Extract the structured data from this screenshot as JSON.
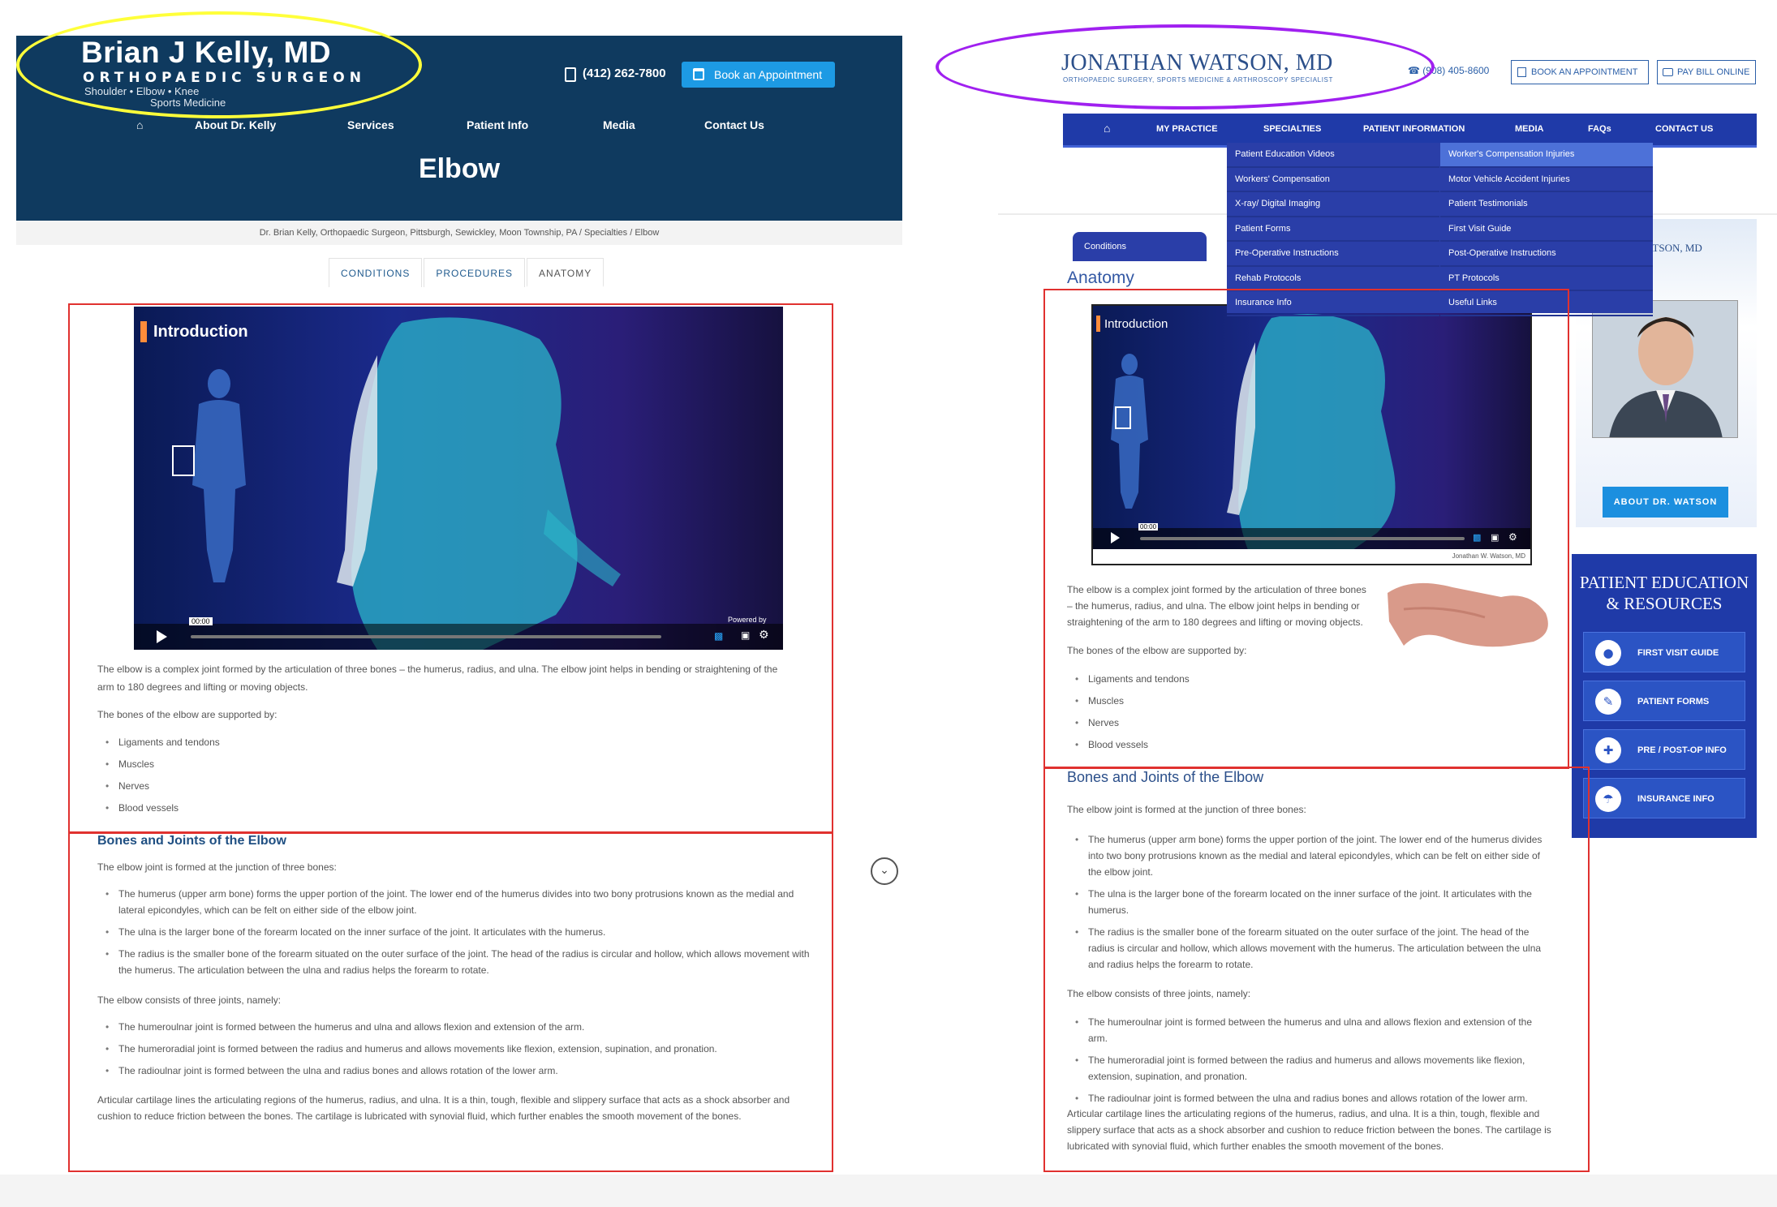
{
  "left_site": {
    "doctor_name": "Brian J Kelly, MD",
    "subtitle": "ORTHOPAEDIC SURGEON",
    "specialties": "Shoulder   •   Elbow   •   Knee",
    "sports": "Sports Medicine",
    "phone": "(412) 262-7800",
    "book_label": "Book an Appointment",
    "nav": [
      "About Dr. Kelly",
      "Services",
      "Patient Info",
      "Media",
      "Contact Us"
    ],
    "page_title": "Elbow",
    "breadcrumb": "Dr. Brian Kelly, Orthopaedic Surgeon, Pittsburgh, Sewickley, Moon Township, PA / Specialties / Elbow",
    "tabs": [
      "CONDITIONS",
      "PROCEDURES",
      "ANATOMY"
    ],
    "video": {
      "intro": "Introduction",
      "time": "00:00",
      "powered": "Powered by"
    },
    "intro_p1": "The elbow is a complex joint formed by the articulation of three bones – the humerus, radius, and ulna. The elbow joint helps in bending or straightening of the arm to 180 degrees and lifting or moving objects.",
    "intro_p2": "The bones of the elbow are supported by:",
    "supports": [
      "Ligaments and tendons",
      "Muscles",
      "Nerves",
      "Blood vessels"
    ],
    "bones_heading": "Bones and Joints of the Elbow",
    "bones_intro": "The elbow joint is formed at the junction of three bones:",
    "bones": [
      "The humerus (upper arm bone) forms the upper portion of the joint. The lower end of the humerus divides into two bony protrusions known as the medial and lateral epicondyles, which can be felt on either side of the elbow joint.",
      "The ulna is the larger bone of the forearm located on the inner surface of the joint. It articulates with the humerus.",
      "The radius is the smaller bone of the forearm situated on the outer surface of the joint. The head of the radius is circular and hollow, which allows movement with the humerus. The articulation between the ulna and radius helps the forearm to rotate."
    ],
    "joints_intro": "The elbow consists of three joints, namely:",
    "joints": [
      "The humeroulnar joint is formed between the humerus and ulna and allows flexion and extension of the arm.",
      "The humeroradial joint is formed between the radius and humerus and allows movements like flexion, extension, supination, and pronation.",
      "The radioulnar joint is formed between the ulna and radius bones and allows rotation of the lower arm."
    ],
    "cartilage": "Articular cartilage lines the articulating regions of the humerus, radius, and ulna. It is a thin, tough, flexible and slippery surface that acts as a shock absorber and cushion to reduce friction between the bones. The cartilage is lubricated with synovial fluid, which further enables the smooth movement of the bones."
  },
  "right_site": {
    "doctor_name": "JONATHAN WATSON, MD",
    "subtitle": "ORTHOPAEDIC SURGERY, SPORTS MEDICINE & ARTHROSCOPY SPECIALIST",
    "phone": "(908) 405-8600",
    "book_label": "BOOK AN APPOINTMENT",
    "pay_label": "PAY BILL ONLINE",
    "nav": [
      "MY PRACTICE",
      "SPECIALTIES",
      "PATIENT INFORMATION",
      "MEDIA",
      "FAQs",
      "CONTACT US"
    ],
    "dropdown_left": [
      "Patient Education Videos",
      "Workers' Compensation",
      "X-ray/ Digital Imaging",
      "Patient Forms",
      "Pre-Operative Instructions",
      "Rehab Protocols",
      "Insurance Info"
    ],
    "dropdown_right": [
      "Worker's Compensation Injuries",
      "Motor Vehicle Accident Injuries",
      "Patient Testimonials",
      "First Visit Guide",
      "Post-Operative Instructions",
      "PT Protocols",
      "Useful Links"
    ],
    "tab_conditions": "Conditions",
    "anatomy_heading": "Anatomy",
    "video": {
      "intro": "Introduction",
      "time": "00:00",
      "credit": "Jonathan W. Watson, MD"
    },
    "intro_p1": "The elbow is a complex joint formed by the articulation of three bones – the humerus, radius, and ulna. The elbow joint helps in bending or straightening of the arm to 180 degrees and lifting or moving objects.",
    "intro_p2": "The bones of the elbow are supported by:",
    "supports": [
      "Ligaments and tendons",
      "Muscles",
      "Nerves",
      "Blood vessels"
    ],
    "bones_heading": "Bones and Joints of the Elbow",
    "bones_intro": "The elbow joint is formed at the junction of three bones:",
    "bones": [
      "The humerus (upper arm bone) forms the upper portion of the joint. The lower end of the humerus divides into two bony protrusions known as the medial and lateral epicondyles, which can be felt on either side of the elbow joint.",
      "The ulna is the larger bone of the forearm located on the inner surface of the joint. It articulates with the humerus.",
      "The radius is the smaller bone of the forearm situated on the outer surface of the joint. The head of the radius is circular and hollow, which allows movement with the humerus. The articulation between the ulna and radius helps the forearm to rotate."
    ],
    "joints_intro": "The elbow consists of three joints, namely:",
    "joints": [
      "The humeroulnar joint is formed between the humerus and ulna and allows flexion and extension of the arm.",
      "The humeroradial joint is formed between the radius and humerus and allows movements like flexion, extension, supination, and pronation.",
      "The radioulnar joint is formed between the ulna and radius bones and allows rotation of the lower arm."
    ],
    "cartilage": "Articular cartilage lines the articulating regions of the humerus, radius, and ulna. It is a thin, tough, flexible and slippery surface that acts as a shock absorber and cushion to reduce friction between the bones. The cartilage is lubricated with synovial fluid, which further enables the smooth movement of the bones.",
    "sidebar_name": "N. WATSON, MD",
    "about_label": "ABOUT DR. WATSON",
    "edu_title": "PATIENT EDUCATION & RESOURCES",
    "edu_buttons": [
      "FIRST VISIT GUIDE",
      "PATIENT FORMS",
      "PRE / POST-OP INFO",
      "INSURANCE INFO"
    ]
  },
  "colors": {
    "left_header": "#0f3a5f",
    "left_button": "#1d9ae4",
    "right_nav": "#1f3aa8",
    "annotation_red": "#e0312f",
    "annotation_yellow": "#ffff3a",
    "annotation_purple": "#a020f0"
  }
}
